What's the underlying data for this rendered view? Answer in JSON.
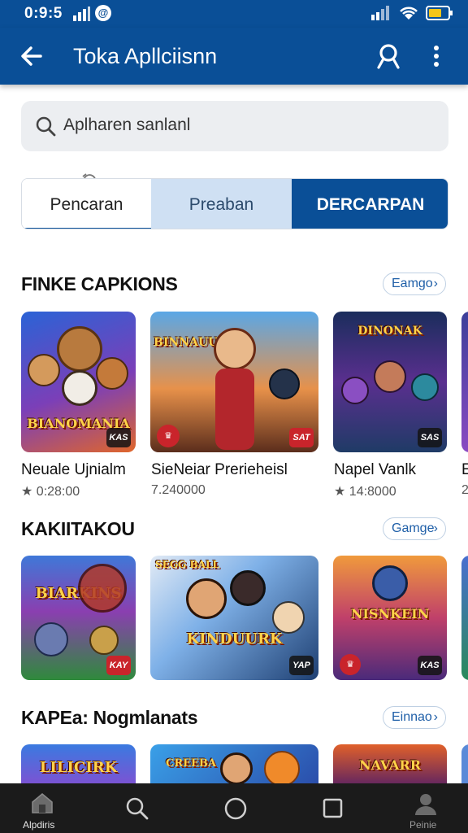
{
  "status_bar": {
    "time": "0:9:5",
    "notification_glyph": "@"
  },
  "app_bar": {
    "title": "Toka Apllciisnn"
  },
  "search": {
    "placeholder": "Aplharen sanlanl"
  },
  "tabs": [
    {
      "label": "Pencaran",
      "state": "selected"
    },
    {
      "label": "Preaban",
      "state": "default"
    },
    {
      "label": "DERCARPAN",
      "state": "filled"
    }
  ],
  "sections": [
    {
      "title": "FINKE CAPKIONS",
      "more_label": "Eamgo",
      "games": [
        {
          "name": "Neuale Ujnialm",
          "meta": "★ 0:28:00",
          "art_text": "BIANOMANIA",
          "badge": "KAS"
        },
        {
          "name": "SieNeiar Prerieheisl",
          "meta": "7.240000",
          "art_text": "BINNAUUK",
          "badge": "SAT"
        },
        {
          "name": "Napel Vanlk",
          "meta": "★ 14:8000",
          "art_text": "DINONAK",
          "badge": "SAS"
        },
        {
          "name": "E",
          "meta": "2"
        }
      ]
    },
    {
      "title": "KAKIITAKOU",
      "more_label": "Gamge",
      "games": [
        {
          "art_text": "BIARKINS",
          "badge": "KAY"
        },
        {
          "art_text": "KINDUURK",
          "badge": "YAP",
          "corner_text": "SEGG BALL"
        },
        {
          "art_text": "NISNKEIN",
          "badge": "KAS"
        }
      ]
    },
    {
      "title": "KAPEa: Nogmlanats",
      "more_label": "Einnao",
      "games": [
        {
          "art_text": "LILICIRK"
        },
        {
          "art_text": "CREEBA"
        },
        {
          "art_text": "NAVARR"
        }
      ]
    }
  ],
  "bottom_nav": [
    {
      "label": "Alpdiris",
      "icon": "home-icon"
    },
    {
      "label": "",
      "icon": "search-icon"
    },
    {
      "label": "",
      "icon": "circle-icon"
    },
    {
      "label": "",
      "icon": "square-icon"
    },
    {
      "label": "Peinie",
      "icon": "profile-icon"
    }
  ]
}
